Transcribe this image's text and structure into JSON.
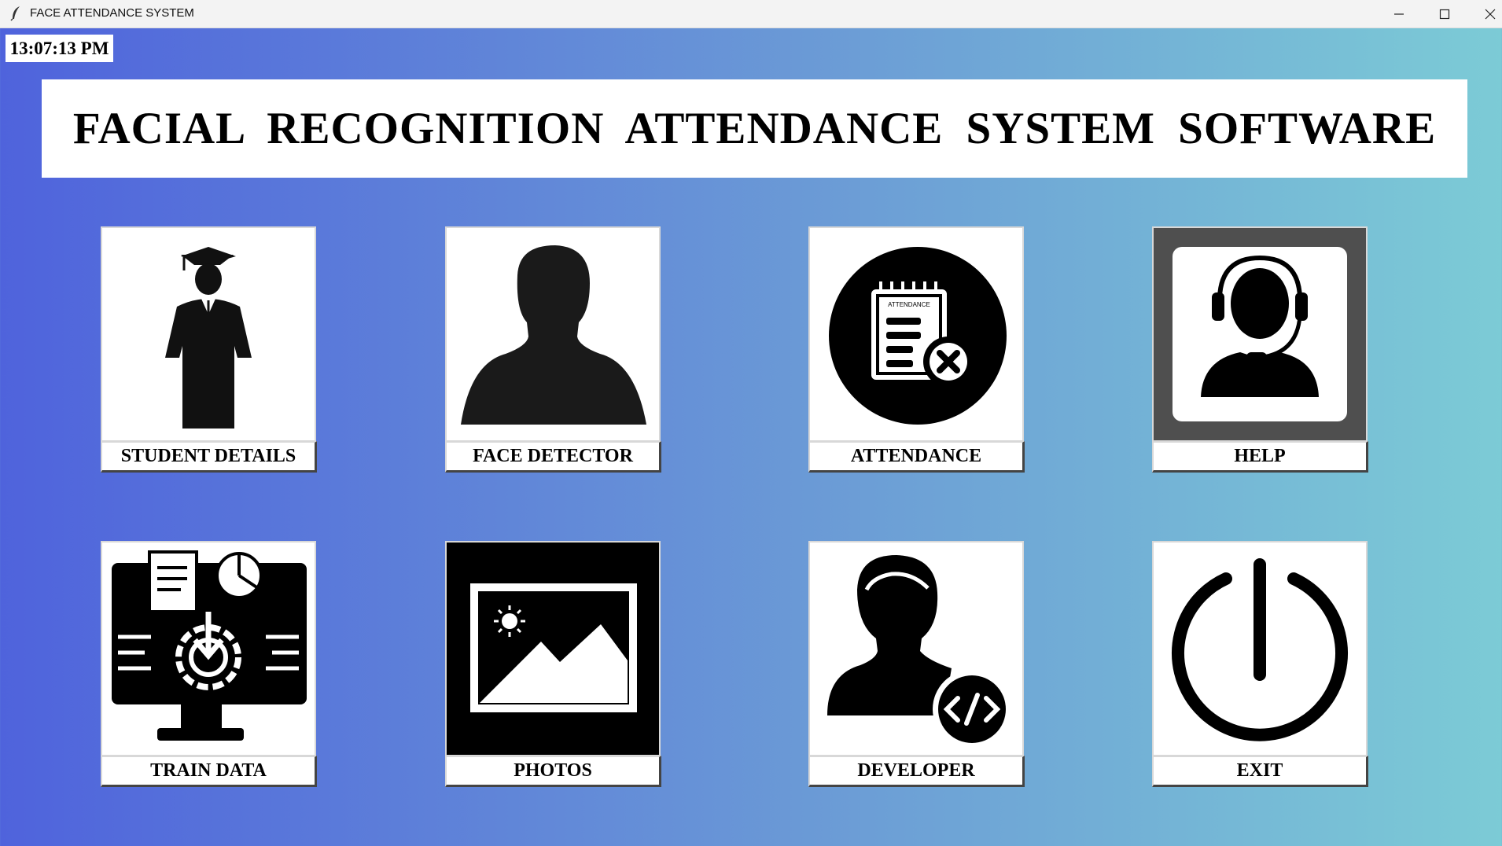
{
  "window": {
    "title": "FACE ATTENDANCE SYSTEM"
  },
  "clock": {
    "time": "13:07:13 PM"
  },
  "header": {
    "title": "FACIAL  RECOGNITION  ATTENDANCE  SYSTEM  SOFTWARE"
  },
  "tiles": [
    {
      "label": "STUDENT DETAILS",
      "icon": "graduate-icon"
    },
    {
      "label": "FACE DETECTOR",
      "icon": "person-silhouette-icon"
    },
    {
      "label": "ATTENDANCE",
      "icon": "attendance-clipboard-icon",
      "badge": "ATTENDANCE"
    },
    {
      "label": "HELP",
      "icon": "headset-support-icon"
    },
    {
      "label": "TRAIN DATA",
      "icon": "monitor-gear-icon"
    },
    {
      "label": "PHOTOS",
      "icon": "image-landscape-icon"
    },
    {
      "label": "DEVELOPER",
      "icon": "developer-code-icon"
    },
    {
      "label": "EXIT",
      "icon": "power-icon"
    }
  ],
  "colors": {
    "gradient_start": "#4f63dc",
    "gradient_end": "#7ccbd6"
  }
}
